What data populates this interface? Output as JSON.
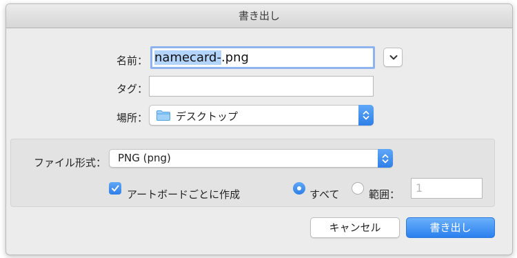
{
  "dialog": {
    "title": "書き出し",
    "name": {
      "label": "名前：",
      "value_selected": "namecard-",
      "value_rest": ".png"
    },
    "tags": {
      "label": "タグ：",
      "value": ""
    },
    "where": {
      "label": "場所：",
      "folder": "デスクトップ",
      "icon": "folder-icon"
    },
    "format": {
      "label": "ファイル形式：",
      "value": "PNG (png)"
    },
    "per_artboard": {
      "label": "アートボードごとに作成",
      "checked": true
    },
    "range": {
      "all_label": "すべて",
      "all_selected": true,
      "range_label": "範囲：",
      "range_value": "1"
    },
    "buttons": {
      "cancel": "キャンセル",
      "export": "書き出し"
    }
  },
  "colors": {
    "accent": "#2f7fe8",
    "selection": "#b3d4fc",
    "focus_ring": "#8eb3ef"
  }
}
